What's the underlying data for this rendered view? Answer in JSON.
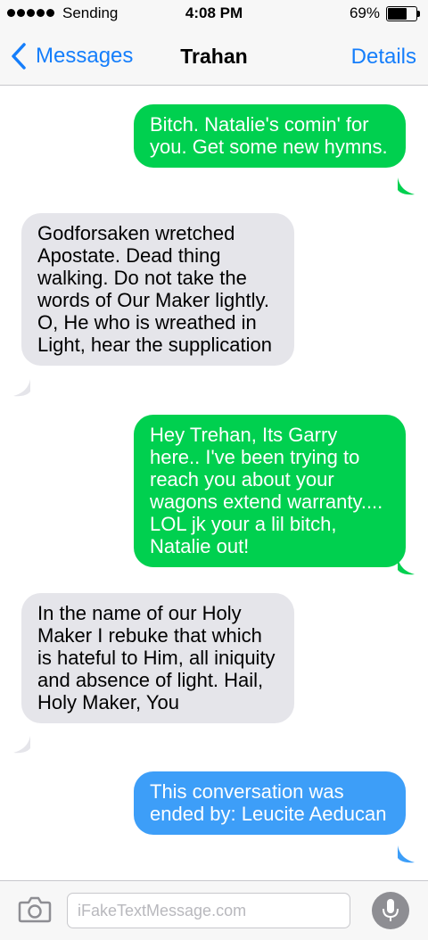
{
  "status_bar": {
    "carrier": "Sending",
    "time": "4:08 PM",
    "battery_percent_label": "69%",
    "battery_level": 0.69,
    "signal_dots": 5,
    "icons": [
      "signal-dots-icon",
      "battery-icon"
    ]
  },
  "nav": {
    "back_label": "Messages",
    "title": "Trahan",
    "details_label": "Details",
    "icons": [
      "chevron-left-icon"
    ]
  },
  "messages": [
    {
      "direction": "sent",
      "text": "Bitch. Natalie's comin' for you. Get some new hymns."
    },
    {
      "direction": "received",
      "text": "Godforsaken wretched Apostate. Dead thing walking. Do not take the words of Our Maker lightly. O, He who is wreathed in Light, hear the supplication"
    },
    {
      "direction": "sent",
      "text": "Hey Trehan, Its Garry here.. I've been trying to reach you about your wagons extend warranty.... LOL jk your a lil bitch, Natalie out!"
    },
    {
      "direction": "received",
      "text": "In the name of our Holy Maker I rebuke that which is hateful to Him, all iniquity and absence of light. Hail, Holy Maker, You"
    },
    {
      "direction": "sent",
      "text": "This conversation was ended by: Leucite Aeducan"
    }
  ],
  "composer": {
    "placeholder": "iFakeTextMessage.com",
    "value": "",
    "icons": [
      "camera-icon",
      "microphone-icon"
    ]
  },
  "colors": {
    "accent_blue": "#157efb",
    "sent_green": "#00d04f",
    "sent_blue": "#3d9ef8",
    "received_gray": "#e5e5ea"
  }
}
